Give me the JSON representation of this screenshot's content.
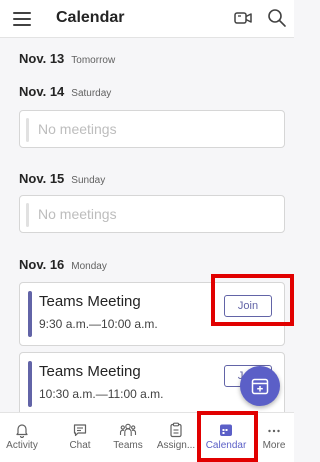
{
  "header": {
    "title": "Calendar",
    "menu_icon": "hamburger-icon",
    "meet_now_icon": "video-camera-icon",
    "search_icon": "search-icon"
  },
  "agenda": [
    {
      "date": "Nov. 13",
      "day": "Tomorrow"
    },
    {
      "date": "Nov. 14",
      "day": "Saturday",
      "empty_text": "No meetings"
    },
    {
      "date": "Nov. 15",
      "day": "Sunday",
      "empty_text": "No meetings"
    },
    {
      "date": "Nov. 16",
      "day": "Monday",
      "meetings": [
        {
          "title": "Teams Meeting",
          "time": "9:30 a.m.—10:00 a.m.",
          "join_label": "Join"
        },
        {
          "title": "Teams Meeting",
          "time": "10:30 a.m.—11:00 a.m.",
          "join_label": "Join"
        }
      ]
    }
  ],
  "fab": {
    "icon": "new-event-icon"
  },
  "bottom_nav": [
    {
      "label": "Activity",
      "icon": "bell-icon"
    },
    {
      "label": "Chat",
      "icon": "chat-icon"
    },
    {
      "label": "Teams",
      "icon": "teams-icon"
    },
    {
      "label": "Assign...",
      "icon": "assignments-icon"
    },
    {
      "label": "Calendar",
      "icon": "calendar-icon",
      "active": true
    },
    {
      "label": "More",
      "icon": "more-icon"
    }
  ],
  "colors": {
    "accent": "#5b5fc7",
    "meeting_bar": "#6264a7",
    "highlight": "#e10000",
    "background": "#f6f6f8"
  }
}
